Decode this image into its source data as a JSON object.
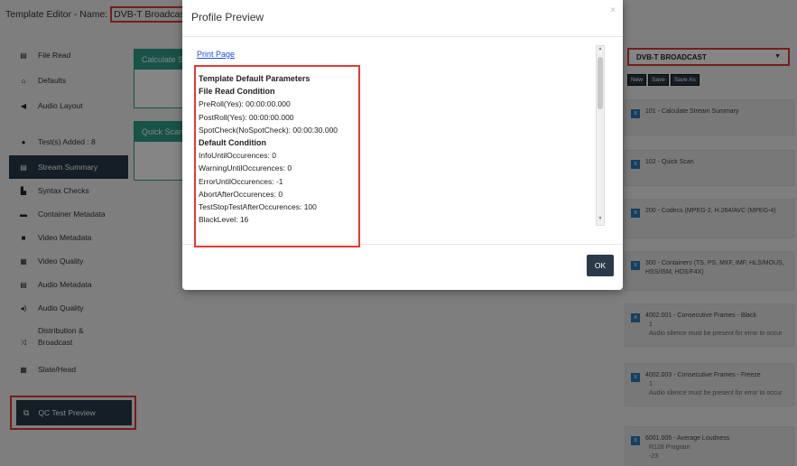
{
  "header": {
    "title_prefix": "Template Editor - Name: ",
    "template_name": "DVB-T Broadcast"
  },
  "sidebar": {
    "items": [
      {
        "label": "File Read",
        "icon": "file-icon"
      },
      {
        "label": "Defaults",
        "icon": "home-icon"
      },
      {
        "label": "Audio Layout",
        "icon": "megaphone-icon"
      },
      {
        "label": "Test(s) Added : 8",
        "icon": "circle-icon"
      },
      {
        "label": "Stream Summary",
        "icon": "list-icon"
      },
      {
        "label": "Syntax Checks",
        "icon": "doc-icon"
      },
      {
        "label": "Container Metadata",
        "icon": "folder-icon"
      },
      {
        "label": "Video Metadata",
        "icon": "video-icon"
      },
      {
        "label": "Video Quality",
        "icon": "film-icon"
      },
      {
        "label": "Audio Metadata",
        "icon": "audio-file-icon"
      },
      {
        "label": "Audio Quality",
        "icon": "speaker-icon"
      },
      {
        "label": "Distribution & Broadcast",
        "icon": "shuffle-icon"
      },
      {
        "label": "Slate/Head",
        "icon": "grid-icon"
      }
    ],
    "qc_button": "QC Test Preview"
  },
  "main": {
    "cards": [
      {
        "label": "Calculate S"
      },
      {
        "label": "Quick Scan"
      }
    ]
  },
  "right_panel": {
    "template_select": "DVB-T BROADCAST",
    "buttons": [
      "New",
      "Save",
      "Save As"
    ],
    "tests": [
      {
        "title": "101 - Calculate Stream Summary",
        "sub": ""
      },
      {
        "title": "102 - Quick Scan",
        "sub": ""
      },
      {
        "title": "200 - Codecs (MPEG-2, H.264/AVC (MPEG-4)",
        "sub": ""
      },
      {
        "title": "300 - Containers (TS, PS, MXF, IMF, HLS/MOUS, HSS/ISM, HDS/F4X)",
        "sub": ""
      },
      {
        "title": "4002.001 - Consecutive Frames - Black",
        "sub": "1\nAudio silence must be present for error to occur"
      },
      {
        "title": "4002.003 - Consecutive Frames - Freeze",
        "sub": "1\nAudio silence must be present for error to occur"
      },
      {
        "title": "6001.005 - Average Loudness",
        "sub": "R128 Program\n-23"
      }
    ]
  },
  "modal": {
    "title": "Profile Preview",
    "print_link": "Print Page",
    "ok_label": "OK",
    "params": {
      "heading": "Template Default Parameters",
      "file_read_heading": "File Read Condition",
      "file_read": [
        "PreRoll(Yes): 00:00:00.000",
        "PostRoll(Yes): 00:00:00.000",
        "SpotCheck(NoSpotCheck): 00:00:30.000"
      ],
      "default_heading": "Default Condition",
      "defaults": [
        "InfoUntilOccurences: 0",
        "WarningUntilOccurences: 0",
        "ErrorUntilOccurences: -1",
        "AbortAfterOccurences: 0",
        "TestStopTestAfterOccurences: 100",
        "BlackLevel: 16"
      ]
    }
  },
  "colors": {
    "highlight": "#e53935",
    "dark_nav": "#2a3a4a",
    "teal": "#2e9e8a",
    "link": "#1a4fd6"
  }
}
